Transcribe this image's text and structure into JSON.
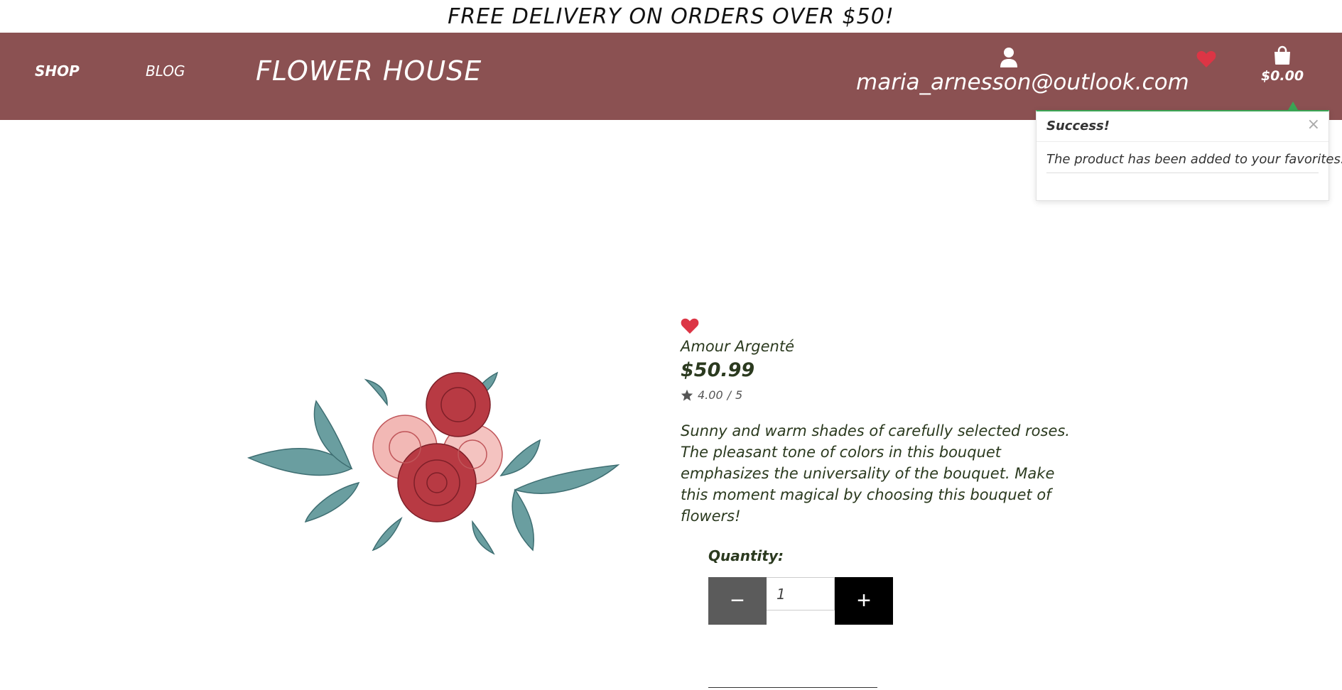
{
  "promo": {
    "text": "FREE DELIVERY ON ORDERS OVER $50!"
  },
  "nav": {
    "shop_label": "SHOP",
    "blog_label": "BLOG",
    "brand": "FLOWER HOUSE",
    "account_email": "maria_arnesson@outlook.com",
    "cart_total": "$0.00",
    "icons": {
      "account": "user-icon",
      "favorites": "heart-icon",
      "cart": "shopping-bag-icon"
    }
  },
  "toast": {
    "title": "Success!",
    "close_glyph": "×",
    "message": "The product has been added to your favorites.",
    "accent_color": "#3aa655"
  },
  "product": {
    "name": "Amour Argenté",
    "price": "$50.99",
    "rating_value": "4.00",
    "rating_separator": "/",
    "rating_max": "5",
    "description": "Sunny and warm shades of carefully selected roses. The pleasant tone of colors in this bouquet emphasizes the universality of the bouquet. Make this moment magical by choosing this bouquet of flowers!",
    "favorited": true
  },
  "quantity": {
    "label": "Quantity:",
    "value": "1",
    "minus_glyph": "−",
    "plus_glyph": "+"
  },
  "colors": {
    "navbar": "#8b5152",
    "heart": "#dc3545",
    "text": "#2b3a1f"
  }
}
